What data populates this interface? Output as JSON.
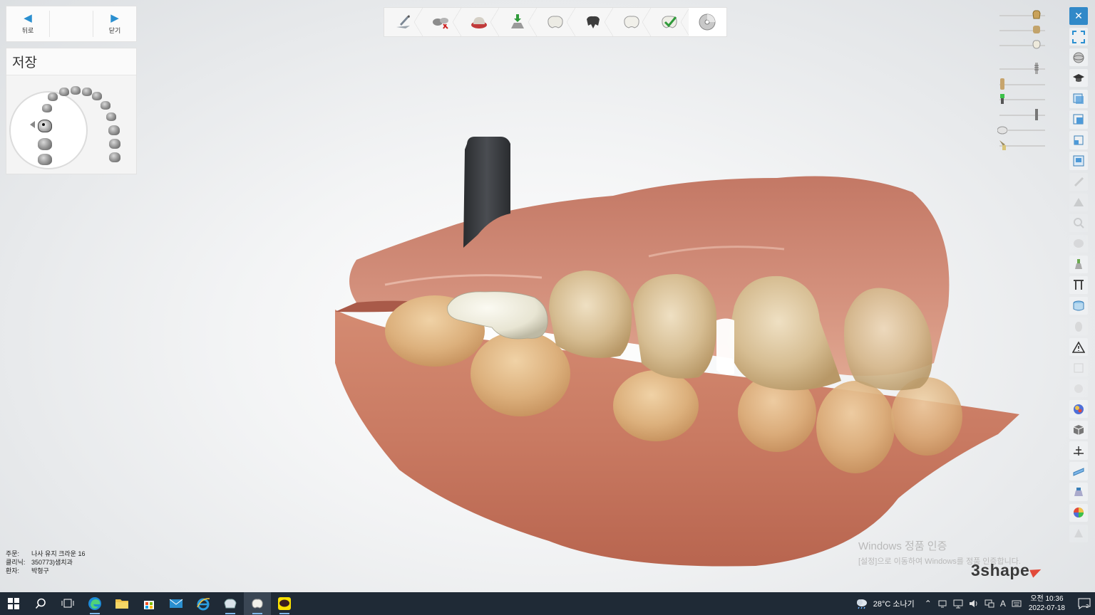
{
  "nav": {
    "back_label": "뒤로",
    "close_label": "닫기"
  },
  "save_panel": {
    "title": "저장"
  },
  "workflow": {
    "steps": [
      {
        "icon": "margin-line-icon"
      },
      {
        "icon": "die-cut-icon"
      },
      {
        "icon": "preparation-icon"
      },
      {
        "icon": "insertion-direction-icon"
      },
      {
        "icon": "crown-anatomy-icon"
      },
      {
        "icon": "coping-icon"
      },
      {
        "icon": "crown-sculpt-icon"
      },
      {
        "icon": "crown-check-icon"
      },
      {
        "icon": "save-disc-icon",
        "active": true
      }
    ]
  },
  "sliders": [
    {
      "icon": "crown-gold-icon",
      "level": 0.85
    },
    {
      "icon": "prep-die-icon",
      "level": 0.85
    },
    {
      "icon": "tooth-white-icon",
      "level": 0.85
    },
    {
      "icon": "implant-icon",
      "level": 0.85
    },
    {
      "icon": "scanbody-icon",
      "level": 0.0
    },
    {
      "icon": "green-abutment-icon",
      "level": 0.0
    },
    {
      "icon": "pin-icon",
      "level": 0.85
    },
    {
      "icon": "gingiva-disc-icon",
      "level": 0.0
    },
    {
      "icon": "brush-icon",
      "level": 0.0
    }
  ],
  "right_toolbar": {
    "close_symbol": "✕",
    "buttons": [
      "fullscreen-icon",
      "view-sphere-icon",
      "graduation-cap-icon",
      "view-front-icon",
      "view-side-icon",
      "view-back-icon",
      "view-top-icon",
      "tool-faded-1-icon",
      "tool-faded-2-icon",
      "tool-faded-3-icon",
      "tool-faded-4-icon",
      "abutment-icon",
      "section-icon",
      "cylinder-icon",
      "tool-faded-5-icon",
      "warning-icon",
      "tool-faded-6-icon",
      "tool-faded-7-icon",
      "colour-map-icon",
      "cube-icon",
      "measure-icon",
      "ruler-icon",
      "scanner-icon",
      "colour-wheel-icon",
      "tool-faded-8-icon"
    ]
  },
  "info": {
    "order_key": "주문:",
    "order_value": "나사 유지 크라운 16",
    "clinic_key": "클리닉:",
    "clinic_value": "350773)샘치과",
    "patient_key": "환자:",
    "patient_value": "박형구"
  },
  "watermark": {
    "line1": "Windows 정품 인증",
    "line2": "[설정]으로 이동하여 Windows를 정품 인증합니다."
  },
  "logo": "3shape",
  "taskbar": {
    "weather": "28°C 소나기",
    "ime": "A",
    "time_period": "오전 10:36",
    "date": "2022-07-18",
    "notify_count": "2"
  },
  "colors": {
    "accent": "#2a8fd0",
    "close_button": "#3189c8",
    "gingiva": "#c97a62",
    "tooth": "#d9c4a0",
    "crown": "#ece9d8",
    "scanbody": "#2f3236",
    "taskbar": "#1f2a36"
  }
}
